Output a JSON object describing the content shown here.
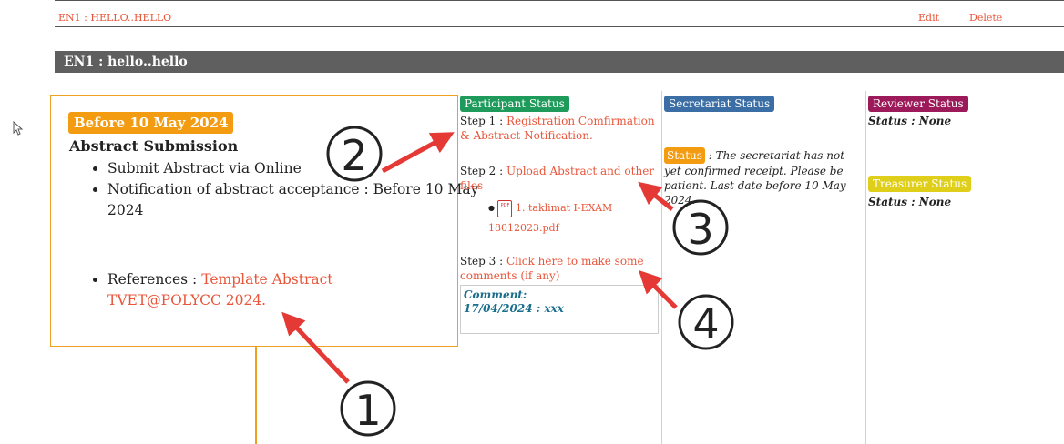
{
  "topbar": {
    "title": "EN1 : HELLO..HELLO",
    "edit": "Edit",
    "delete": "Delete"
  },
  "section_title": "EN1 : hello..hello",
  "submission": {
    "badge": "Before 10 May 2024",
    "heading": "Abstract Submission",
    "items": [
      "Submit Abstract via Online",
      "Notification of abstract acceptance : Before 10 May 2024"
    ],
    "references_label": "References : ",
    "references_link": "Template Abstract TVET@POLYCC 2024."
  },
  "participant": {
    "badge": "Participant Status",
    "step1_label": "Step 1 : ",
    "step1_link": "Registration Comfirmation & Abstract Notification.",
    "step2_label": "Step 2 : ",
    "step2_link": "Upload Abstract and other files",
    "file_link": "1. taklimat I-EXAM 18012023.pdf",
    "step3_label": "Step 3 : ",
    "step3_link": "Click here to make some comments (if any)",
    "comment_label": "Comment:",
    "comment_text": "17/04/2024 : xxx"
  },
  "secretariat": {
    "badge": "Secretariat Status",
    "status_tag": "Status",
    "status_text": " : The secretariat has not yet confirmed receipt. Please be patient. Last date before 10 May 2024."
  },
  "reviewer": {
    "badge": "Reviewer Status",
    "status": "Status : None"
  },
  "treasurer": {
    "badge": "Treasurer Status",
    "status": "Status : None"
  },
  "annotations": [
    "1",
    "2",
    "3",
    "4"
  ],
  "colors": {
    "link": "#e8553a",
    "orange": "#f39c12",
    "participant": "#1e9a5a",
    "secretariat": "#3b6ea5",
    "reviewer": "#9c1a5a",
    "treasurer": "#e0cf1a",
    "arrow": "#e53935"
  }
}
